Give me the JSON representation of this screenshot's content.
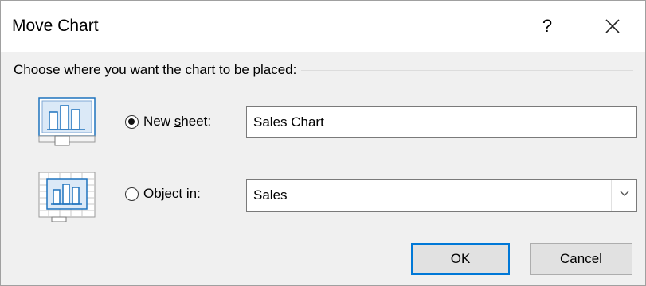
{
  "window": {
    "title": "Move Chart",
    "help_label": "?"
  },
  "group": {
    "label": "Choose where you want the chart to be placed:"
  },
  "options": {
    "new_sheet": {
      "label_pre": "New ",
      "label_accel": "s",
      "label_post": "heet:",
      "selected": true,
      "value": "Sales Chart"
    },
    "object_in": {
      "label_pre": "",
      "label_accel": "O",
      "label_post": "bject in:",
      "selected": false,
      "value": "Sales"
    }
  },
  "buttons": {
    "ok": "OK",
    "cancel": "Cancel"
  },
  "icons": {
    "close": "close-icon",
    "new_sheet": "chart-sheet-icon",
    "object_in": "embedded-chart-icon",
    "dropdown": "chevron-down-icon"
  },
  "colors": {
    "accent": "#0078d7",
    "icon_blue": "#1e73be",
    "dialog_bg": "#f0f0f0"
  }
}
